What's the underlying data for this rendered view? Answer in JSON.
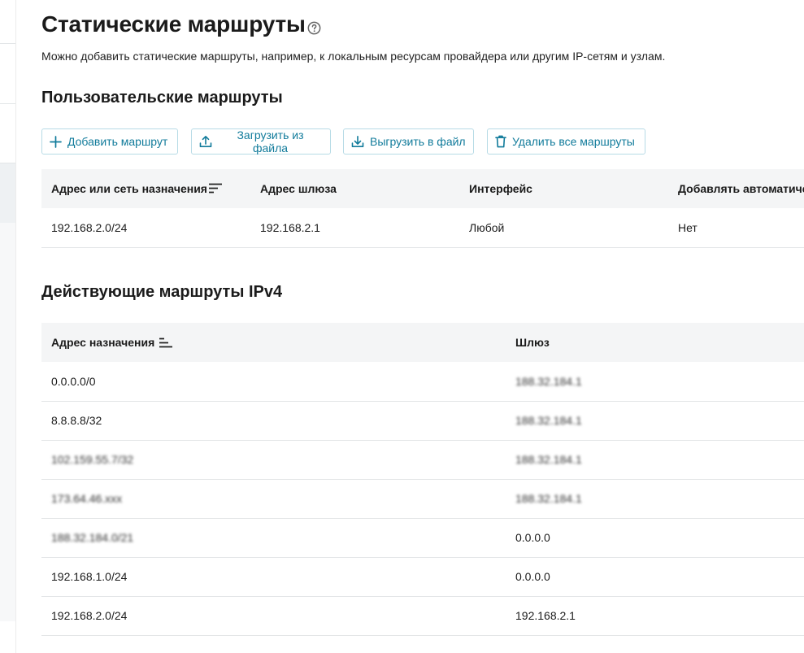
{
  "page": {
    "title": "Статические маршруты",
    "description": "Можно добавить статические маршруты, например, к локальным ресурсам провайдера или другим IP-сетям и узлам."
  },
  "user_routes": {
    "title": "Пользовательские маршруты",
    "actions": {
      "add": "Добавить маршрут",
      "upload": "Загрузить из файла",
      "download": "Выгрузить в файл",
      "delete_all": "Удалить все маршруты"
    },
    "columns": {
      "destination": "Адрес или сеть назначения",
      "gateway": "Адрес шлюза",
      "interface": "Интерфейс",
      "auto": "Добавлять автоматиче"
    },
    "rows": [
      {
        "destination": "192.168.2.0/24",
        "gateway": "192.168.2.1",
        "interface": "Любой",
        "auto": "Нет"
      }
    ]
  },
  "active_routes": {
    "title": "Действующие маршруты IPv4",
    "columns": {
      "destination": "Адрес назначения",
      "gateway": "Шлюз"
    },
    "rows": [
      {
        "destination": "0.0.0.0/0",
        "gateway": "188.32.184.1"
      },
      {
        "destination": "8.8.8.8/32",
        "gateway": "188.32.184.1"
      },
      {
        "destination": "102.159.55.7/32",
        "gateway": "188.32.184.1"
      },
      {
        "destination": "173.64.46.xxx",
        "gateway": "188.32.184.1"
      },
      {
        "destination": "188.32.184.0/21",
        "gateway": "0.0.0.0"
      },
      {
        "destination": "192.168.1.0/24",
        "gateway": "0.0.0.0"
      },
      {
        "destination": "192.168.2.0/24",
        "gateway": "192.168.2.1"
      }
    ]
  },
  "colors": {
    "accent": "#117b9b",
    "button_border": "#b7dbe6",
    "header_bg": "#f4f5f6"
  }
}
